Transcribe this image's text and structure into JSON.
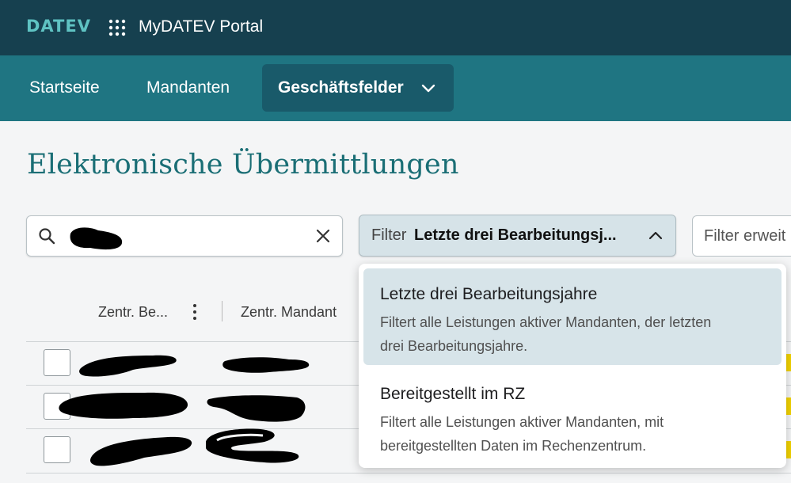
{
  "header": {
    "logo": "DATEV",
    "apps_icon": "apps-grid-icon",
    "title": "MyDATEV Portal"
  },
  "nav": {
    "items": [
      {
        "label": "Startseite"
      },
      {
        "label": "Mandanten"
      },
      {
        "label": "Geschäftsfelder",
        "active": true,
        "icon": "chevron-down-icon"
      }
    ]
  },
  "page": {
    "title": "Elektronische Übermittlungen"
  },
  "search": {
    "icon": "search-icon",
    "value": "",
    "clear_icon": "close-icon"
  },
  "filter": {
    "prefix": "Filter",
    "value": "Letzte drei Bearbeitungsj...",
    "icon": "chevron-up-icon",
    "expanded": true
  },
  "filter_extended": {
    "label": "Filter erweit"
  },
  "table": {
    "columns": [
      {
        "label": "Zentr. Be..."
      },
      {
        "label": "Zentr. Mandant"
      }
    ],
    "column_menu_icon": "kebab-menu-icon",
    "rows": [
      {
        "checked": false
      },
      {
        "checked": false
      },
      {
        "checked": false
      }
    ]
  },
  "dropdown": {
    "options": [
      {
        "title": "Letzte drei Bearbeitungsjahre",
        "description": "Filtert alle Leistungen aktiver Mandanten, der letzten drei Bearbeitungsjahre.",
        "selected": true
      },
      {
        "title": "Bereitgestellt im RZ",
        "description": "Filtert alle Leistungen aktiver Mandanten, mit bereitgestellten Daten im Rechenzentrum.",
        "selected": false
      }
    ]
  },
  "colors": {
    "topbar": "#16404f",
    "navbar": "#1f7582",
    "nav_active": "#195a6a",
    "accent_title": "#1a6e75",
    "logo": "#5fc3c3",
    "selected_option": "#d7e4e9"
  }
}
